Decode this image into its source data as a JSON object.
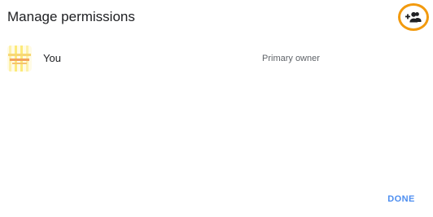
{
  "dialog": {
    "title": "Manage permissions",
    "add_person_icon": "person-add-icon",
    "highlight_color": "#f29a0e"
  },
  "permissions": [
    {
      "name": "You",
      "role": "Primary owner",
      "avatar_icon": "user-avatar"
    }
  ],
  "footer": {
    "done_label": "DONE",
    "accent_color": "#4d8ef0"
  }
}
